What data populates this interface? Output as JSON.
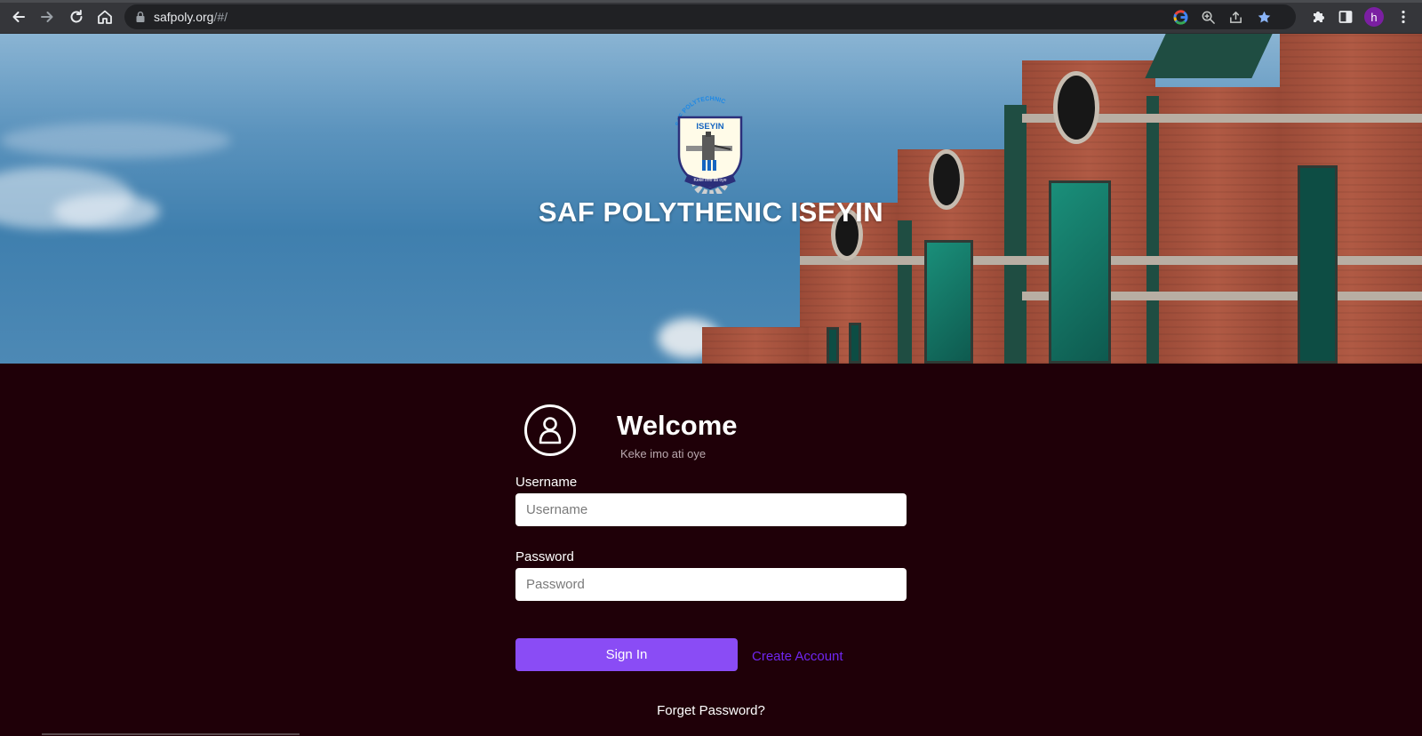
{
  "browser": {
    "url_host": "safpoly.org",
    "url_path": "/#/",
    "profile_initial": "h",
    "icons": {
      "back": "back-arrow-icon",
      "forward": "forward-arrow-icon",
      "reload": "reload-icon",
      "home": "home-icon",
      "lock": "lock-icon",
      "google": "google-icon",
      "zoom": "zoom-icon",
      "share": "share-icon",
      "bookmark": "star-icon",
      "extensions": "puzzle-icon",
      "sidepanel": "side-panel-icon",
      "menu": "kebab-menu-icon"
    },
    "colors": {
      "bookmark_star": "#8ab4f8",
      "avatar": "#7b1fa2"
    }
  },
  "hero": {
    "logo": {
      "arc_text": "SAF POLYTECHNIC",
      "banner": "ISEYIN",
      "motto": "Keke imo ati oye"
    },
    "title": "SAF POLYTHENIC ISEYIN"
  },
  "login": {
    "welcome": "Welcome",
    "tagline": "Keke imo ati oye",
    "username_label": "Username",
    "username_placeholder": "Username",
    "username_value": "",
    "password_label": "Password",
    "password_placeholder": "Password",
    "password_value": "",
    "signin_label": "Sign In",
    "create_account_label": "Create Account",
    "forgot_label": "Forget Password?",
    "colors": {
      "background": "#1f0008",
      "signin_button": "#8a4cf5",
      "create_link": "#6f26f0"
    }
  }
}
